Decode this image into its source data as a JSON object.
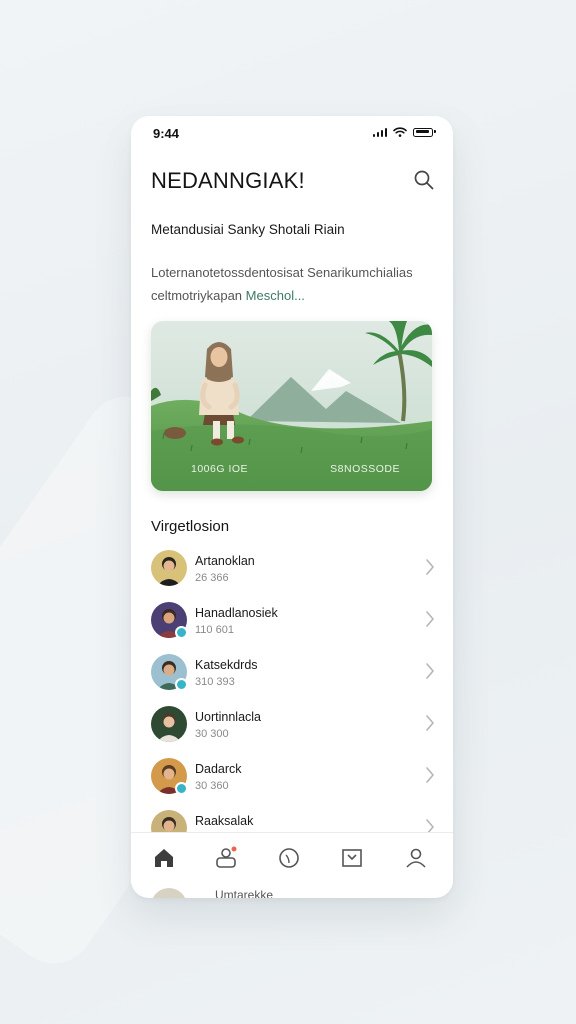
{
  "status": {
    "time": "9:44"
  },
  "header": {
    "title": "NEDANNGIAK!",
    "search_icon": "search-icon"
  },
  "subtitle": "Metandusiai Sanky Shotali Riain",
  "description": {
    "text": "Loternanotetossdentosisat Senarikumchialias celtmotriykapan",
    "link": "Meschol..."
  },
  "hero": {
    "caption_left": "1006G IOE",
    "caption_right": "S8NOSSODE"
  },
  "section": {
    "title": "Virgetlosion"
  },
  "list": {
    "items": [
      {
        "name": "Artanoklan",
        "meta": "26 366",
        "badge": ""
      },
      {
        "name": "Hanadlanosiek",
        "meta": "110 601",
        "badge": "#36b5c8"
      },
      {
        "name": "Katsekdrds",
        "meta": "310 393",
        "badge": "#36b5c8"
      },
      {
        "name": "Uortinnlacla",
        "meta": "30 300",
        "badge": ""
      },
      {
        "name": "Dadarck",
        "meta": "30 360",
        "badge": "#36b5c8"
      },
      {
        "name": "Raaksalak",
        "meta": "",
        "badge": ""
      }
    ]
  },
  "tabs": [
    {
      "name": "home-icon"
    },
    {
      "name": "profile-card-icon"
    },
    {
      "name": "heart-icon"
    },
    {
      "name": "bookmark-icon"
    },
    {
      "name": "person-icon"
    }
  ],
  "peek_item": {
    "name": "Umtarekke"
  },
  "colors": {
    "accent": "#3f7a63",
    "hero_green": "#5f9d55",
    "tab_notify": "#e8664a"
  }
}
